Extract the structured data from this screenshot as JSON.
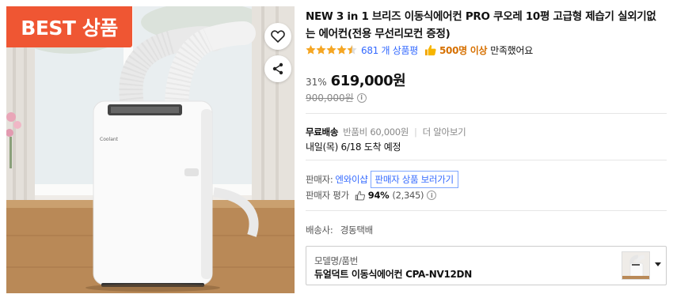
{
  "image": {
    "badge": "BEST 상품",
    "badge_color": "#ef5633",
    "brand_text": "Coolant",
    "wish_icon": "heart-icon",
    "share_icon": "share-icon"
  },
  "product": {
    "title": "NEW 3 in 1 브리즈 이동식에어컨 PRO 쿠오레 10평 고급형 제습기 실외기없는 에어컨(전용 무선리모컨 증정)",
    "rating_stars": 4.5,
    "review_count": "681 개 상품평",
    "satisfied_count": "500명 이상",
    "satisfied_text": "만족했어요"
  },
  "price": {
    "discount": "31%",
    "sale_price": "619,000원",
    "original_price": "900,000원"
  },
  "shipping": {
    "label": "무료배송",
    "return_fee": "반품비 60,000원",
    "separator": "|",
    "more": "더 알아보기",
    "arrival_date": "내일(목) 6/18",
    "arrival_text": "도착 예정"
  },
  "seller": {
    "label": "판매자:",
    "name": "엔와이샵",
    "button": "판매자 상품 보러가기",
    "rating_label": "판매자 평가",
    "rating_pct": "94%",
    "rating_count": "(2,345)"
  },
  "courier": {
    "label": "배송사:",
    "name": "경동택배"
  },
  "option": {
    "label": "모델명/품번",
    "value": "듀얼덕트 이동식에어컨 CPA-NV12DN"
  },
  "colors": {
    "accent_blue": "#346aff",
    "star": "#f5a623",
    "satisfied": "#d67000"
  }
}
